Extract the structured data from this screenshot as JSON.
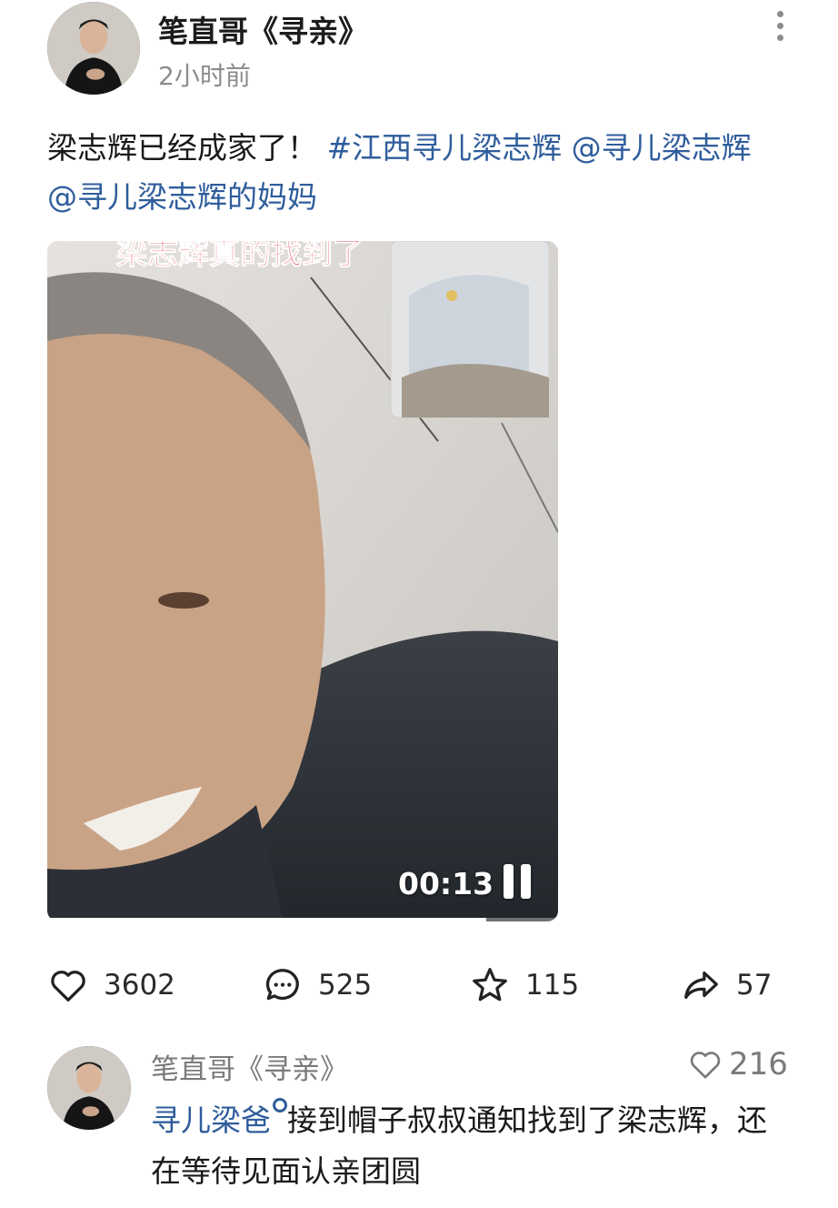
{
  "post": {
    "author": "笔直哥《寻亲》",
    "time": "2小时前",
    "text_prefix": "梁志辉已经成家了！",
    "hashtag": "#江西寻儿梁志辉",
    "mention_1": "@寻儿梁志辉",
    "mention_2": "@寻儿梁志辉的妈妈"
  },
  "video": {
    "timestamp": "00:13",
    "overlay_caption": "梁志辉真的找到了",
    "progress": 0.86
  },
  "actions": {
    "likes": "3602",
    "comments": "525",
    "favorites": "115",
    "shares": "57"
  },
  "comment": {
    "author": "笔直哥《寻亲》",
    "likes": "216",
    "mention": "寻儿梁爸",
    "text": "接到帽子叔叔通知找到了梁志辉，还在等待见面认亲团圆"
  },
  "colors": {
    "link": "#2f5d9c",
    "muted_text": "#8c8c8c"
  }
}
